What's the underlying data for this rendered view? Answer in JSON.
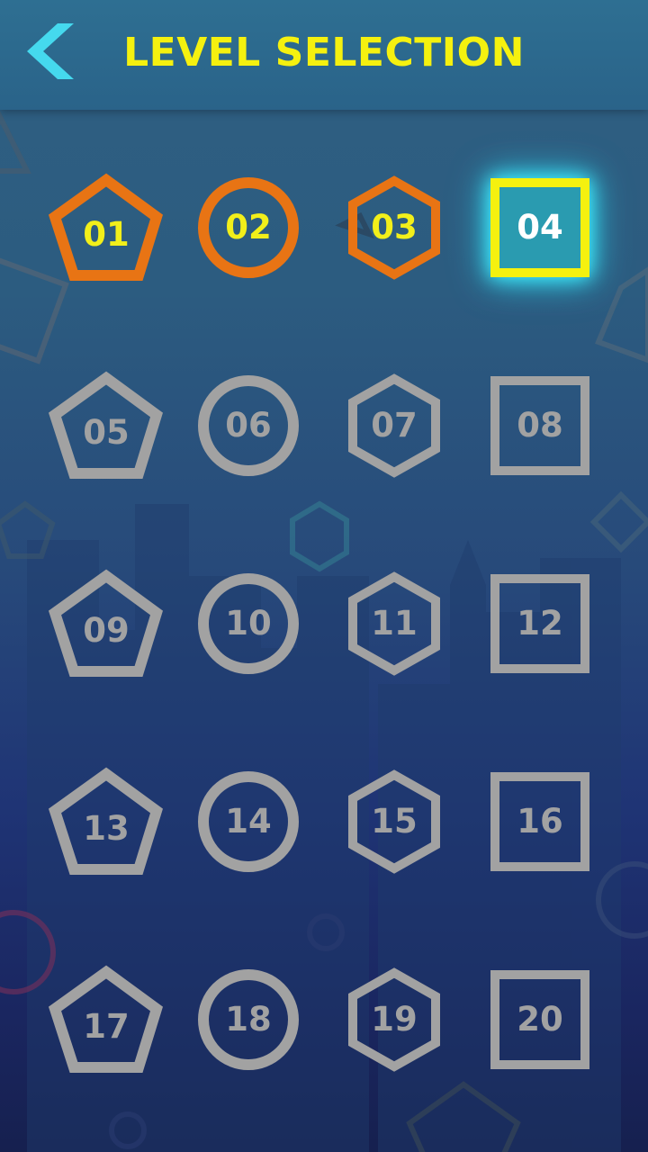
{
  "header": {
    "title": "LEVEL SELECTION",
    "back_icon": "chevron-left-icon",
    "back_color": "#45d9ee"
  },
  "colors": {
    "completed": "#e87414",
    "completed_text": "#f2ef1a",
    "current": "#f5f10f",
    "current_fill": "#2a9bb0",
    "current_text": "#ffffff",
    "locked": "#a2a2a2",
    "title": "#f5f10f"
  },
  "levels": [
    {
      "label": "01",
      "shape": "pentagon",
      "state": "completed"
    },
    {
      "label": "02",
      "shape": "circle",
      "state": "completed"
    },
    {
      "label": "03",
      "shape": "hexagon",
      "state": "completed"
    },
    {
      "label": "04",
      "shape": "square",
      "state": "current"
    },
    {
      "label": "05",
      "shape": "pentagon",
      "state": "locked"
    },
    {
      "label": "06",
      "shape": "circle",
      "state": "locked"
    },
    {
      "label": "07",
      "shape": "hexagon",
      "state": "locked"
    },
    {
      "label": "08",
      "shape": "square",
      "state": "locked"
    },
    {
      "label": "09",
      "shape": "pentagon",
      "state": "locked"
    },
    {
      "label": "10",
      "shape": "circle",
      "state": "locked"
    },
    {
      "label": "11",
      "shape": "hexagon",
      "state": "locked"
    },
    {
      "label": "12",
      "shape": "square",
      "state": "locked"
    },
    {
      "label": "13",
      "shape": "pentagon",
      "state": "locked"
    },
    {
      "label": "14",
      "shape": "circle",
      "state": "locked"
    },
    {
      "label": "15",
      "shape": "hexagon",
      "state": "locked"
    },
    {
      "label": "16",
      "shape": "square",
      "state": "locked"
    },
    {
      "label": "17",
      "shape": "pentagon",
      "state": "locked"
    },
    {
      "label": "18",
      "shape": "circle",
      "state": "locked"
    },
    {
      "label": "19",
      "shape": "hexagon",
      "state": "locked"
    },
    {
      "label": "20",
      "shape": "square",
      "state": "locked"
    }
  ]
}
